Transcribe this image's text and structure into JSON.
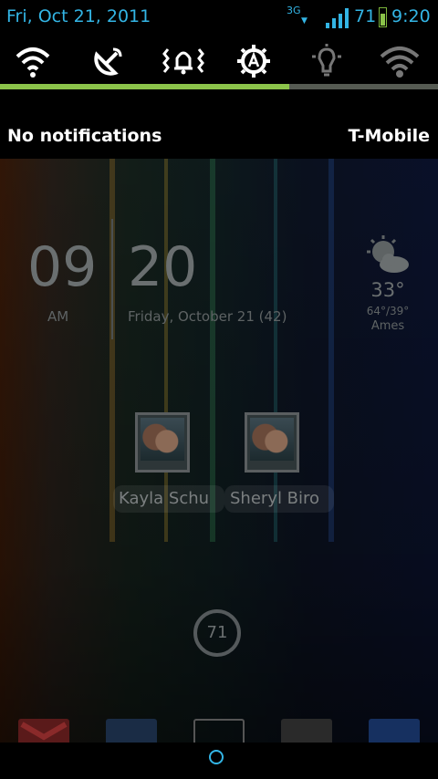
{
  "status_bar": {
    "date": "Fri, Oct 21, 2011",
    "network_type": "3G",
    "battery_percent": "71",
    "time": "9:20",
    "icons": [
      "signal-icon",
      "battery-charging-icon"
    ]
  },
  "quick_toggles": [
    {
      "name": "wifi-toggle",
      "icon": "wifi-icon"
    },
    {
      "name": "gps-toggle",
      "icon": "satellite-dish-icon"
    },
    {
      "name": "sound-toggle",
      "icon": "vibrate-bell-icon"
    },
    {
      "name": "auto-rotate-toggle",
      "icon": "auto-gear-icon"
    },
    {
      "name": "flashlight-toggle",
      "icon": "lightbulb-icon"
    },
    {
      "name": "wifi-hotspot-toggle",
      "icon": "hotspot-icon"
    }
  ],
  "brightness": {
    "level": 0.66,
    "color": "#8bc34a"
  },
  "notifications": {
    "empty_label": "No notifications",
    "carrier": "T-Mobile"
  },
  "home_screen": {
    "clock": {
      "hour": "09",
      "minute": "20",
      "ampm": "AM",
      "date": "Friday, October 21 (42)"
    },
    "weather": {
      "icon": "sun-behind-cloud-icon",
      "temp": "33°",
      "range": "64°/39°",
      "city": "Ames"
    },
    "contacts": [
      {
        "name": "Kayla Schu"
      },
      {
        "name": "Sheryl Biro"
      }
    ],
    "battery_widget": {
      "value": "71"
    },
    "dock": [
      "gmail-icon",
      "app-icon",
      "app-drawer-icon",
      "app-icon",
      "app-icon"
    ]
  },
  "accent_color": "#33b5e5"
}
